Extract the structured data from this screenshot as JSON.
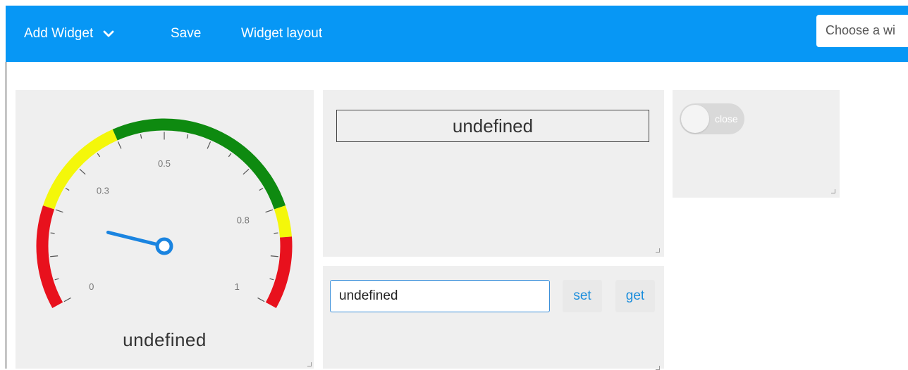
{
  "toolbar": {
    "add_widget_label": "Add Widget",
    "save_label": "Save",
    "widget_layout_label": "Widget layout",
    "choose_widget_placeholder": "Choose a wi",
    "background_color": "#0797f5"
  },
  "gauge": {
    "value_text": "undefined",
    "min": 0,
    "max": 1,
    "tick_labels": [
      "0",
      "0.3",
      "0.5",
      "0.8",
      "1"
    ],
    "needle_value": 0.18,
    "bands": [
      {
        "from": 0,
        "to": 0.2,
        "color": "#e8111d"
      },
      {
        "from": 0.2,
        "to": 0.4,
        "color": "#f4f70a"
      },
      {
        "from": 0.4,
        "to": 0.8,
        "color": "#0e8a10"
      },
      {
        "from": 0.8,
        "to": 0.86,
        "color": "#f4f70a"
      },
      {
        "from": 0.86,
        "to": 1,
        "color": "#e8111d"
      }
    ],
    "needle_color": "#1a84e0"
  },
  "display": {
    "value_text": "undefined"
  },
  "toggle": {
    "label": "close",
    "state": "off"
  },
  "input_widget": {
    "value": "undefined",
    "set_label": "set",
    "get_label": "get"
  }
}
